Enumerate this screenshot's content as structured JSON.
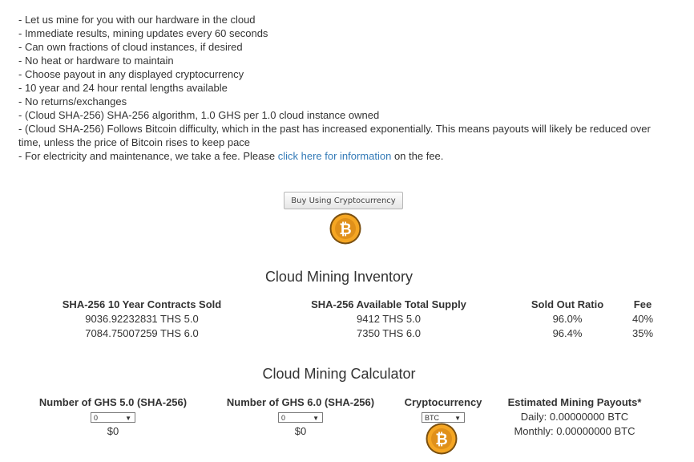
{
  "features": [
    "- Let us mine for you with our hardware in the cloud",
    "- Immediate results, mining updates every 60 seconds",
    "- Can own fractions of cloud instances, if desired",
    "- No heat or hardware to maintain",
    "- Choose payout in any displayed cryptocurrency",
    "- 10 year and 24 hour rental lengths available",
    "- No returns/exchanges",
    "- (Cloud SHA-256) SHA-256 algorithm, 1.0 GHS per 1.0 cloud instance owned",
    "- (Cloud SHA-256) Follows Bitcoin difficulty, which in the past has increased exponentially. This means payouts will likely be reduced over time, unless the price of Bitcoin rises to keep pace"
  ],
  "fee_line": {
    "before": "- For electricity and maintenance, we take a fee. Please ",
    "link": "click here for information",
    "after": " on the fee."
  },
  "buy_button": "Buy Using Cryptocurrency",
  "inventory": {
    "title": "Cloud Mining Inventory",
    "contracts_header": "SHA-256 10 Year Contracts Sold",
    "contracts": [
      "9036.92232831 THS 5.0",
      "7084.75007259 THS 6.0"
    ],
    "supply_header": "SHA-256 Available Total Supply",
    "supply": [
      "9412 THS 5.0",
      "7350 THS 6.0"
    ],
    "ratio_header": "Sold Out Ratio",
    "ratio": [
      "96.0%",
      "96.4%"
    ],
    "fee_header": "Fee",
    "fee": [
      "40%",
      "35%"
    ]
  },
  "calculator": {
    "title": "Cloud Mining Calculator",
    "ghs5_header": "Number of GHS 5.0 (SHA-256)",
    "ghs5_value": "0",
    "ghs5_cost": "$0",
    "ghs6_header": "Number of GHS 6.0 (SHA-256)",
    "ghs6_value": "0",
    "ghs6_cost": "$0",
    "crypto_header": "Cryptocurrency",
    "crypto_value": "BTC",
    "payout_header": "Estimated Mining Payouts*",
    "daily": "Daily: 0.00000000 BTC",
    "monthly": "Monthly: 0.00000000 BTC"
  },
  "colors": {
    "link": "#337ab7",
    "coin": "#f5a623"
  },
  "icons": {
    "coin": "bitcoin-icon",
    "arrow": "triangle-down-icon"
  }
}
